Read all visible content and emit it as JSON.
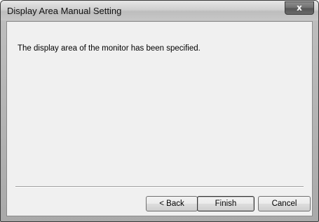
{
  "window": {
    "title": "Display Area Manual Setting",
    "close_glyph": "x"
  },
  "content": {
    "message": "The display area of the monitor has been specified."
  },
  "buttons": {
    "back": "< Back",
    "finish": "Finish",
    "cancel": "Cancel"
  }
}
